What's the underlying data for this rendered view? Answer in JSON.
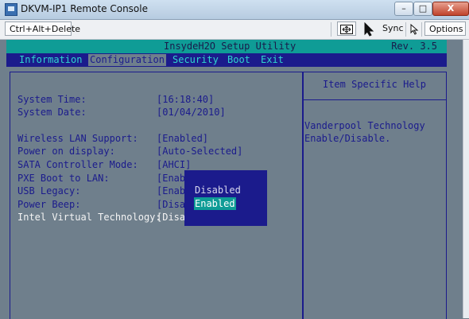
{
  "window": {
    "title": "DKVM-IP1 Remote Console",
    "minimize_glyph": "–",
    "maximize_glyph": "□",
    "close_glyph": "X"
  },
  "toolbar": {
    "ctrl_alt_delete": "Ctrl+Alt+Delete",
    "fit_icon": "fit-screen-icon",
    "sync": "Sync",
    "options": "Options"
  },
  "bios": {
    "title": "InsydeH2O Setup Utility",
    "rev": "Rev. 3.5",
    "menu": [
      {
        "label": "Information"
      },
      {
        "label": "Configuration"
      },
      {
        "label": "Security"
      },
      {
        "label": "Boot"
      },
      {
        "label": "Exit"
      }
    ],
    "active_menu": "Configuration",
    "settings": [
      {
        "label": "System Time:",
        "value": "[16:18:40]"
      },
      {
        "label": "System Date:",
        "value": "[01/04/2010]"
      },
      {
        "label": "Wireless LAN Support:",
        "value": "[Enabled]"
      },
      {
        "label": "Power on display:",
        "value": "[Auto-Selected]"
      },
      {
        "label": "SATA Controller Mode:",
        "value": "[AHCI]"
      },
      {
        "label": "PXE Boot to LAN:",
        "value": "[Enab"
      },
      {
        "label": "USB Legacy:",
        "value": "[Enab"
      },
      {
        "label": "Power Beep:",
        "value": "[Disa"
      },
      {
        "label": "Intel Virtual Technology:",
        "value": "[Disa"
      }
    ],
    "help": {
      "title": "Item Specific Help",
      "line1": "Vanderpool Technology",
      "line2": "Enable/Disable."
    },
    "popup": {
      "options": [
        "Disabled",
        "Enabled"
      ],
      "selected": "Enabled"
    }
  },
  "colors": {
    "bios_bg": "#6f7f8c",
    "bios_text": "#1b1b8c",
    "header_bg": "#0f9c96",
    "menubar_bg": "#1b1b8c",
    "menu_text": "#2fd6cf"
  }
}
